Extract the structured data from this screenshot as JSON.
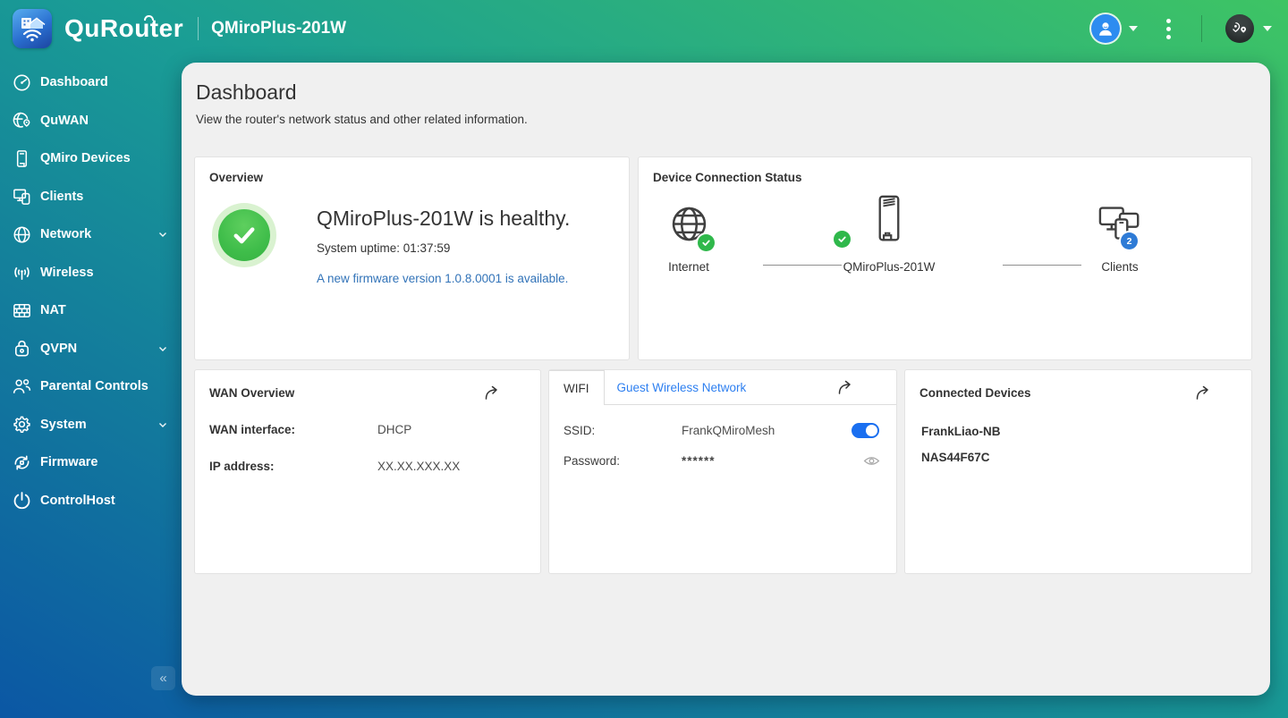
{
  "header": {
    "app_name": "QuRouter",
    "device_name": "QMiroPlus-201W"
  },
  "sidebar": {
    "items": [
      {
        "label": "Dashboard",
        "expandable": false
      },
      {
        "label": "QuWAN",
        "expandable": false
      },
      {
        "label": "QMiro Devices",
        "expandable": false
      },
      {
        "label": "Clients",
        "expandable": false
      },
      {
        "label": "Network",
        "expandable": true
      },
      {
        "label": "Wireless",
        "expandable": false
      },
      {
        "label": "NAT",
        "expandable": false
      },
      {
        "label": "QVPN",
        "expandable": true
      },
      {
        "label": "Parental Controls",
        "expandable": false
      },
      {
        "label": "System",
        "expandable": true
      },
      {
        "label": "Firmware",
        "expandable": false
      },
      {
        "label": "ControlHost",
        "expandable": false
      }
    ],
    "collapse_glyph": "«"
  },
  "page": {
    "title": "Dashboard",
    "subtitle": "View the router's network status and other related information."
  },
  "overview": {
    "title": "Overview",
    "health_status": "QMiroPlus-201W is healthy.",
    "uptime": "System uptime: 01:37:59",
    "firmware_notice": "A new firmware version 1.0.8.0001 is available."
  },
  "connection": {
    "title": "Device Connection Status",
    "internet_label": "Internet",
    "router_label": "QMiroPlus-201W",
    "clients_label": "Clients",
    "clients_count": "2"
  },
  "wan": {
    "title": "WAN Overview",
    "interface_label": "WAN interface:",
    "interface_value": "DHCP",
    "ip_label": "IP address:",
    "ip_value": "XX.XX.XXX.XX"
  },
  "wifi": {
    "tab_wifi": "WIFI",
    "tab_guest": "Guest Wireless Network",
    "ssid_label": "SSID:",
    "ssid_value": "FrankQMiroMesh",
    "ssid_enabled": true,
    "password_label": "Password:",
    "password_value": "******"
  },
  "connected_devices": {
    "title": "Connected Devices",
    "devices": [
      "FrankLiao-NB",
      "NAS44F67C"
    ]
  },
  "colors": {
    "gradient_green": "#3ec464",
    "gradient_teal": "#1a9d95",
    "gradient_blue": "#0b57a4",
    "link_blue": "#3273b8",
    "guest_link_blue": "#2d7ff0",
    "toggle_blue": "#1a6ff0",
    "healthy_green": "#3fbd4a",
    "badge_green": "#2fb84b",
    "badge_blue": "#2e7bd6"
  }
}
